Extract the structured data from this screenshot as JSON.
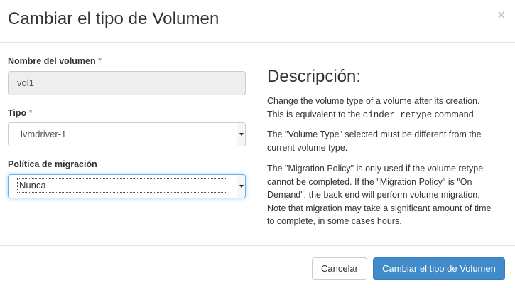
{
  "modal": {
    "title": "Cambiar el tipo de Volumen",
    "close_symbol": "×"
  },
  "form": {
    "volume_name": {
      "label": "Nombre del volumen",
      "required_mark": "*",
      "value": "vol1"
    },
    "type": {
      "label": "Tipo",
      "required_mark": "*",
      "selected": "lvmdriver-1"
    },
    "migration_policy": {
      "label": "Política de migración",
      "selected": "Nunca"
    }
  },
  "description": {
    "title": "Descripción:",
    "p1_a": "Change the volume type of a volume after its creation.",
    "p1_b": "This is equivalent to the ",
    "p1_code": "cinder retype",
    "p1_c": " command.",
    "p2_a": "The \"Volume Type\" selected must be different from the",
    "p2_b": "current volume type.",
    "p3_l1": "The \"Migration Policy\" is only used if the volume retype",
    "p3_l2": "cannot be completed. If the \"Migration Policy\" is \"On",
    "p3_l3": "Demand\", the back end will perform volume migration.",
    "p3_l4": "Note that migration may take a significant amount of time",
    "p3_l5": "to complete, in some cases hours."
  },
  "footer": {
    "cancel_label": "Cancelar",
    "submit_label": "Cambiar el tipo de Volumen"
  },
  "colors": {
    "primary": "#428bca",
    "required": "#428bca",
    "focus": "#66afe9"
  }
}
